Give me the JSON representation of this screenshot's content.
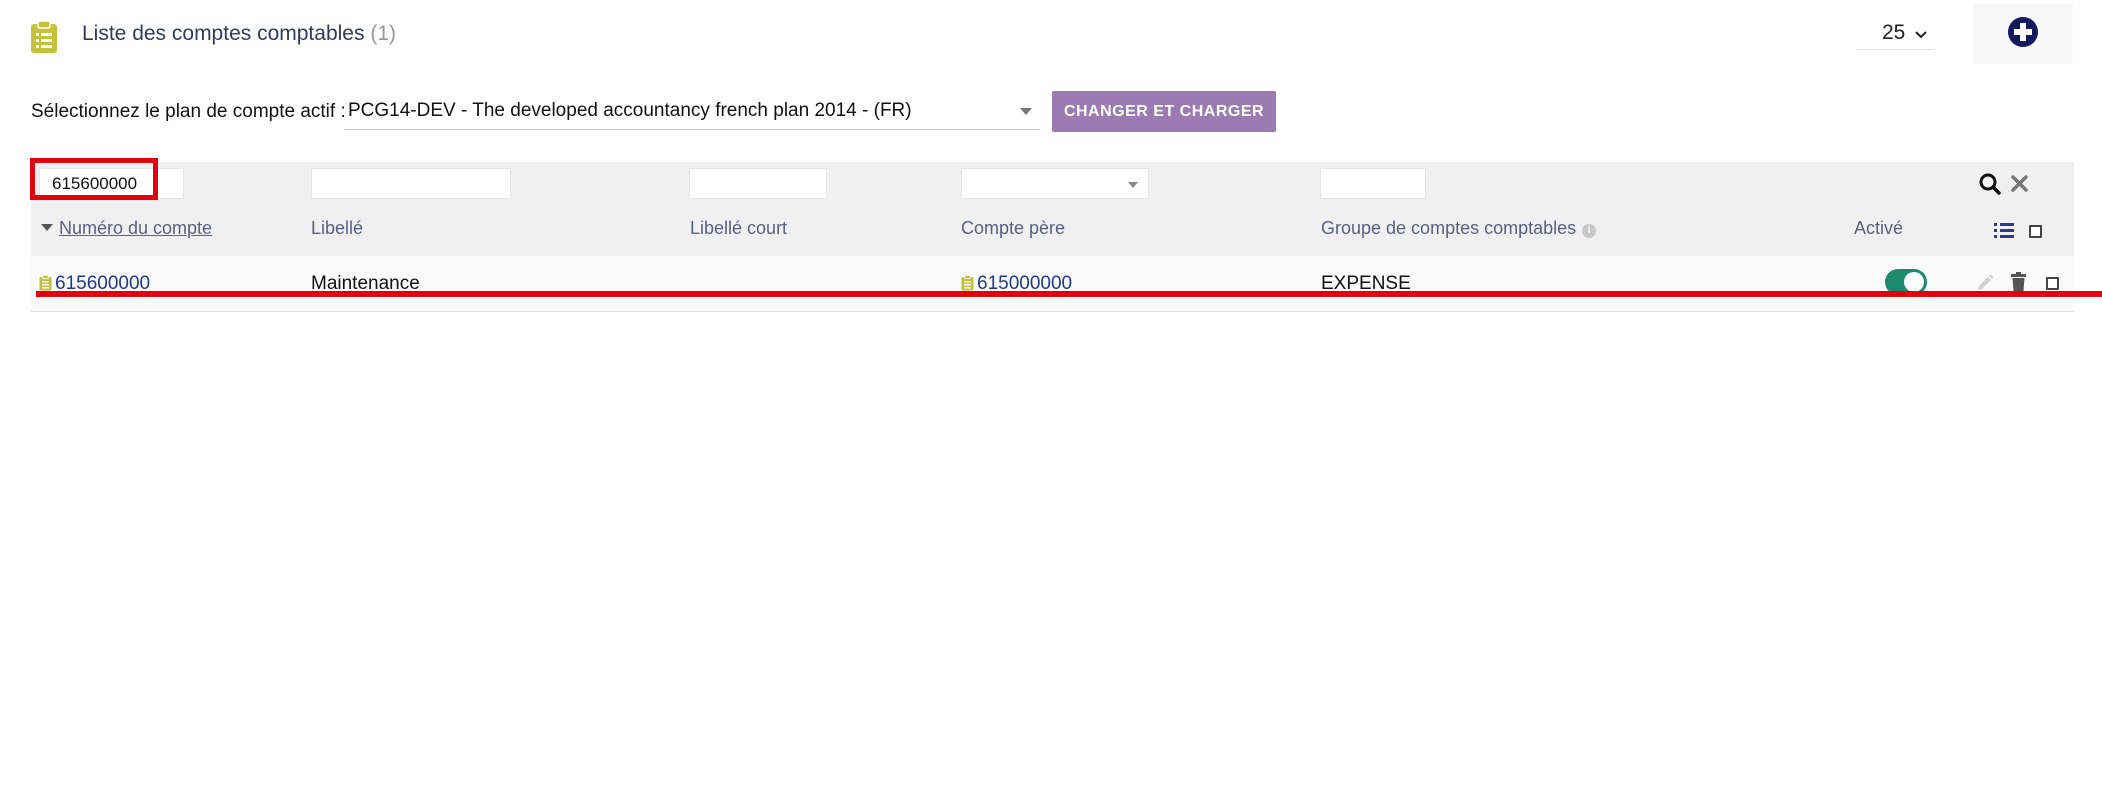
{
  "header": {
    "title": "Liste des comptes comptables",
    "count": "(1)",
    "per_page": "25",
    "icon": "clipboard-list-icon",
    "add_icon": "plus-circle-icon"
  },
  "plan": {
    "label": "Sélectionnez le plan de compte actif :",
    "selected": "PCG14-DEV - The developed accountancy french plan 2014 - (FR)",
    "button": "CHANGER ET CHARGER"
  },
  "filters": {
    "numero": "615600000",
    "libelle": "",
    "libelle_court": "",
    "compte_pere": "",
    "groupe": ""
  },
  "columns": {
    "numero": "Numéro du compte",
    "libelle": "Libellé",
    "libelle_court": "Libellé court",
    "compte_pere": "Compte père",
    "groupe": "Groupe de comptes comptables",
    "active": "Activé"
  },
  "rows": [
    {
      "numero": "615600000",
      "libelle": "Maintenance",
      "libelle_court": "",
      "compte_pere": "615000000",
      "groupe": "EXPENSE",
      "active": true
    }
  ],
  "colors": {
    "accent": "#9c7bb2",
    "link": "#1f3a8a",
    "toggle_on": "#1d8a6e",
    "annotation": "#e3000f",
    "icon_olive": "#c4c23a"
  }
}
